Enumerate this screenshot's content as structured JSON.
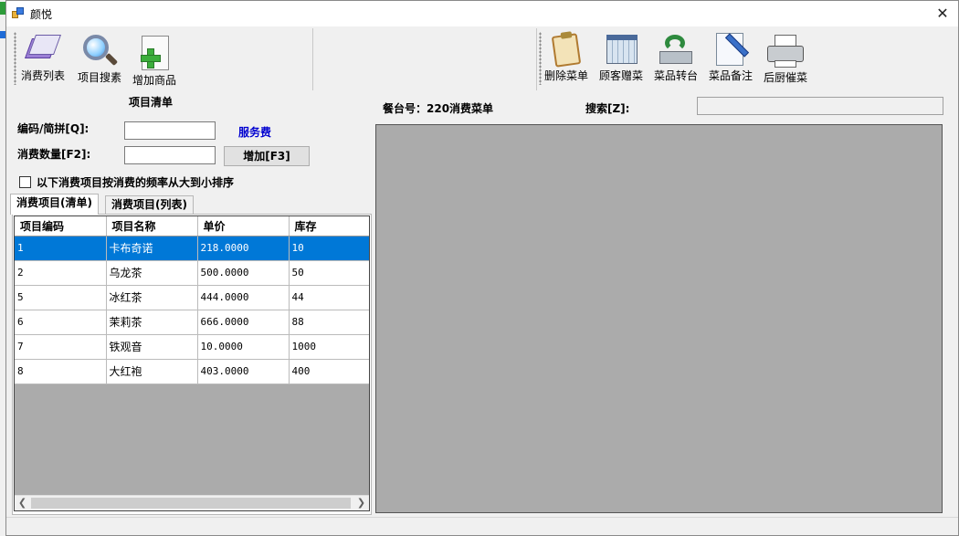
{
  "window": {
    "title": "颜悦",
    "close_glyph": "✕"
  },
  "toolbar_left": [
    {
      "label": "消费列表",
      "icon": "consume-list-icon"
    },
    {
      "label": "项目搜素",
      "icon": "magnifier-icon"
    },
    {
      "label": "增加商品",
      "icon": "add-item-icon"
    }
  ],
  "toolbar_right": [
    {
      "label": "删除菜单",
      "icon": "clipboard-icon"
    },
    {
      "label": "顾客赠菜",
      "icon": "calendar-grid-icon"
    },
    {
      "label": "菜品转台",
      "icon": "transfer-icon"
    },
    {
      "label": "菜品备注",
      "icon": "note-pencil-icon"
    },
    {
      "label": "后厨催菜",
      "icon": "printer-icon"
    }
  ],
  "form": {
    "panel_title": "项目清单",
    "code_label": "编码/简拼[Q]:",
    "code_value": "",
    "service_fee": "服务费",
    "qty_label": "消费数量[F2]:",
    "qty_value": "",
    "add_button": "增加[F3]",
    "sort_checkbox_label": "以下消费项目按消费的频率从大到小排序",
    "sort_checked": false
  },
  "tabs": [
    {
      "label": "消费项目(清单)",
      "active": true
    },
    {
      "label": "消费项目(列表)",
      "active": false
    }
  ],
  "grid": {
    "columns": [
      "项目编码",
      "项目名称",
      "单价",
      "库存"
    ],
    "rows": [
      [
        "1",
        "卡布奇诺",
        "218.0000",
        "10"
      ],
      [
        "2",
        "乌龙茶",
        "500.0000",
        "50"
      ],
      [
        "5",
        "冰红茶",
        "444.0000",
        "44"
      ],
      [
        "6",
        "茉莉茶",
        "666.0000",
        "88"
      ],
      [
        "7",
        "铁观音",
        "10.0000",
        "1000"
      ],
      [
        "8",
        "大红袍",
        "403.0000",
        "400"
      ]
    ],
    "selected_row": 0
  },
  "order": {
    "table_label": "餐台号：220消费菜单",
    "search_label": "搜索[Z]:",
    "search_value": ""
  },
  "colors": {
    "selection": "#0078d7",
    "service_link": "#0000d0",
    "empty_area": "#ababab"
  }
}
